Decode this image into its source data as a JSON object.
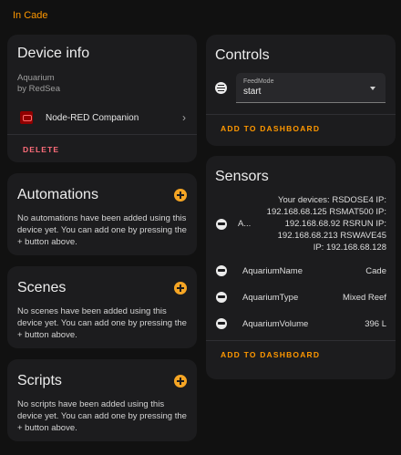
{
  "area_link": "In Cade",
  "device_info": {
    "title": "Device info",
    "name": "Aquarium",
    "manufacturer": "by RedSea",
    "integration": "Node-RED Companion",
    "delete_label": "DELETE"
  },
  "automations": {
    "title": "Automations",
    "empty_text": "No automations have been added using this device yet. You can add one by pressing the + button above."
  },
  "scenes": {
    "title": "Scenes",
    "empty_text": "No scenes have been added using this device yet. You can add one by pressing the + button above."
  },
  "scripts": {
    "title": "Scripts",
    "empty_text": "No scripts have been added using this device yet. You can add one by pressing the + button above."
  },
  "controls": {
    "title": "Controls",
    "select_label": "FeedMode",
    "select_value": "start",
    "select_icon": "hamburger-icon",
    "add_to_dashboard": "ADD TO DASHBOARD"
  },
  "sensors": {
    "title": "Sensors",
    "items": [
      {
        "name": "A...",
        "value": "Your devices: RSDOSE4 IP: 192.168.68.125 RSMAT500 IP: 192.168.68.92 RSRUN IP: 192.168.68.213 RSWAVE45 IP: 192.168.68.128",
        "icon": "sensor-icon"
      },
      {
        "name": "AquariumName",
        "value": "Cade",
        "icon": "sensor-icon"
      },
      {
        "name": "AquariumType",
        "value": "Mixed Reef",
        "icon": "sensor-icon"
      },
      {
        "name": "AquariumVolume",
        "value": "396 L",
        "icon": "sensor-icon"
      }
    ],
    "add_to_dashboard": "ADD TO DASHBOARD"
  },
  "colors": {
    "accent": "#ff9800",
    "delete": "#ff6d7a",
    "card_bg": "#1c1c1e",
    "page_bg": "#111111"
  }
}
